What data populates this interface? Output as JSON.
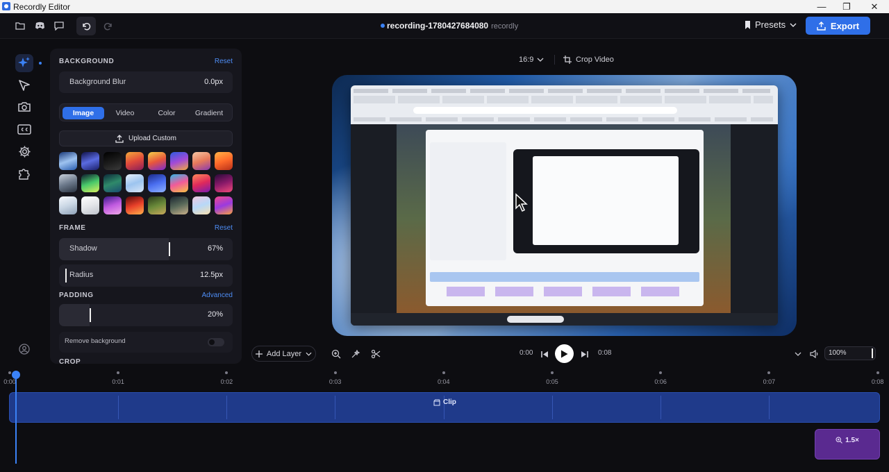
{
  "window": {
    "title": "Recordly Editor"
  },
  "project": {
    "name": "recording-1780427684080",
    "subtitle": "recordly"
  },
  "toolbar": {
    "presets_label": "Presets",
    "export_label": "Export"
  },
  "panel": {
    "background": {
      "heading": "BACKGROUND",
      "reset_label": "Reset",
      "blur_label": "Background Blur",
      "blur_value": "0.0px",
      "tabs": [
        "Image",
        "Video",
        "Color",
        "Gradient"
      ],
      "active_tab": "Image",
      "upload_label": "Upload Custom"
    },
    "frame": {
      "heading": "FRAME",
      "reset_label": "Reset",
      "shadow_label": "Shadow",
      "shadow_value": "67%",
      "radius_label": "Radius",
      "radius_value": "12.5px"
    },
    "padding": {
      "heading": "PADDING",
      "advanced_label": "Advanced",
      "value": "20%",
      "remove_bg_label": "Remove background"
    },
    "crop": {
      "heading": "CROP"
    }
  },
  "preview": {
    "aspect_ratio": "16:9",
    "crop_label": "Crop Video"
  },
  "playback": {
    "add_layer_label": "Add Layer",
    "current_time": "0:00",
    "duration": "0:08",
    "zoom_level": "100%"
  },
  "timeline": {
    "ticks": [
      "0:00",
      "0:01",
      "0:02",
      "0:03",
      "0:04",
      "0:05",
      "0:06",
      "0:07",
      "0:08"
    ],
    "clip_label": "Clip",
    "zoom_clip_label": "1.5×"
  },
  "colors": {
    "accent": "#2f6fe8",
    "clip": "#1f3a8a",
    "zoom_clip": "#5a2a90"
  },
  "wallpapers": [
    "blue-wave",
    "indigo-wave",
    "dark-black",
    "sunset-red",
    "rainbow-wave",
    "violet-ribbon",
    "peach-ribbon",
    "orange-glow",
    "grey-mist",
    "green-aurora",
    "teal-hills",
    "sky-soft",
    "blue-ribbon",
    "pink-orange",
    "red-pink",
    "magenta-night",
    "white-cloud",
    "silver-light",
    "purple-haze",
    "crimson-flare",
    "forest-field",
    "mountain-dusk",
    "pastel-rainbow",
    "pink-sunrise"
  ]
}
